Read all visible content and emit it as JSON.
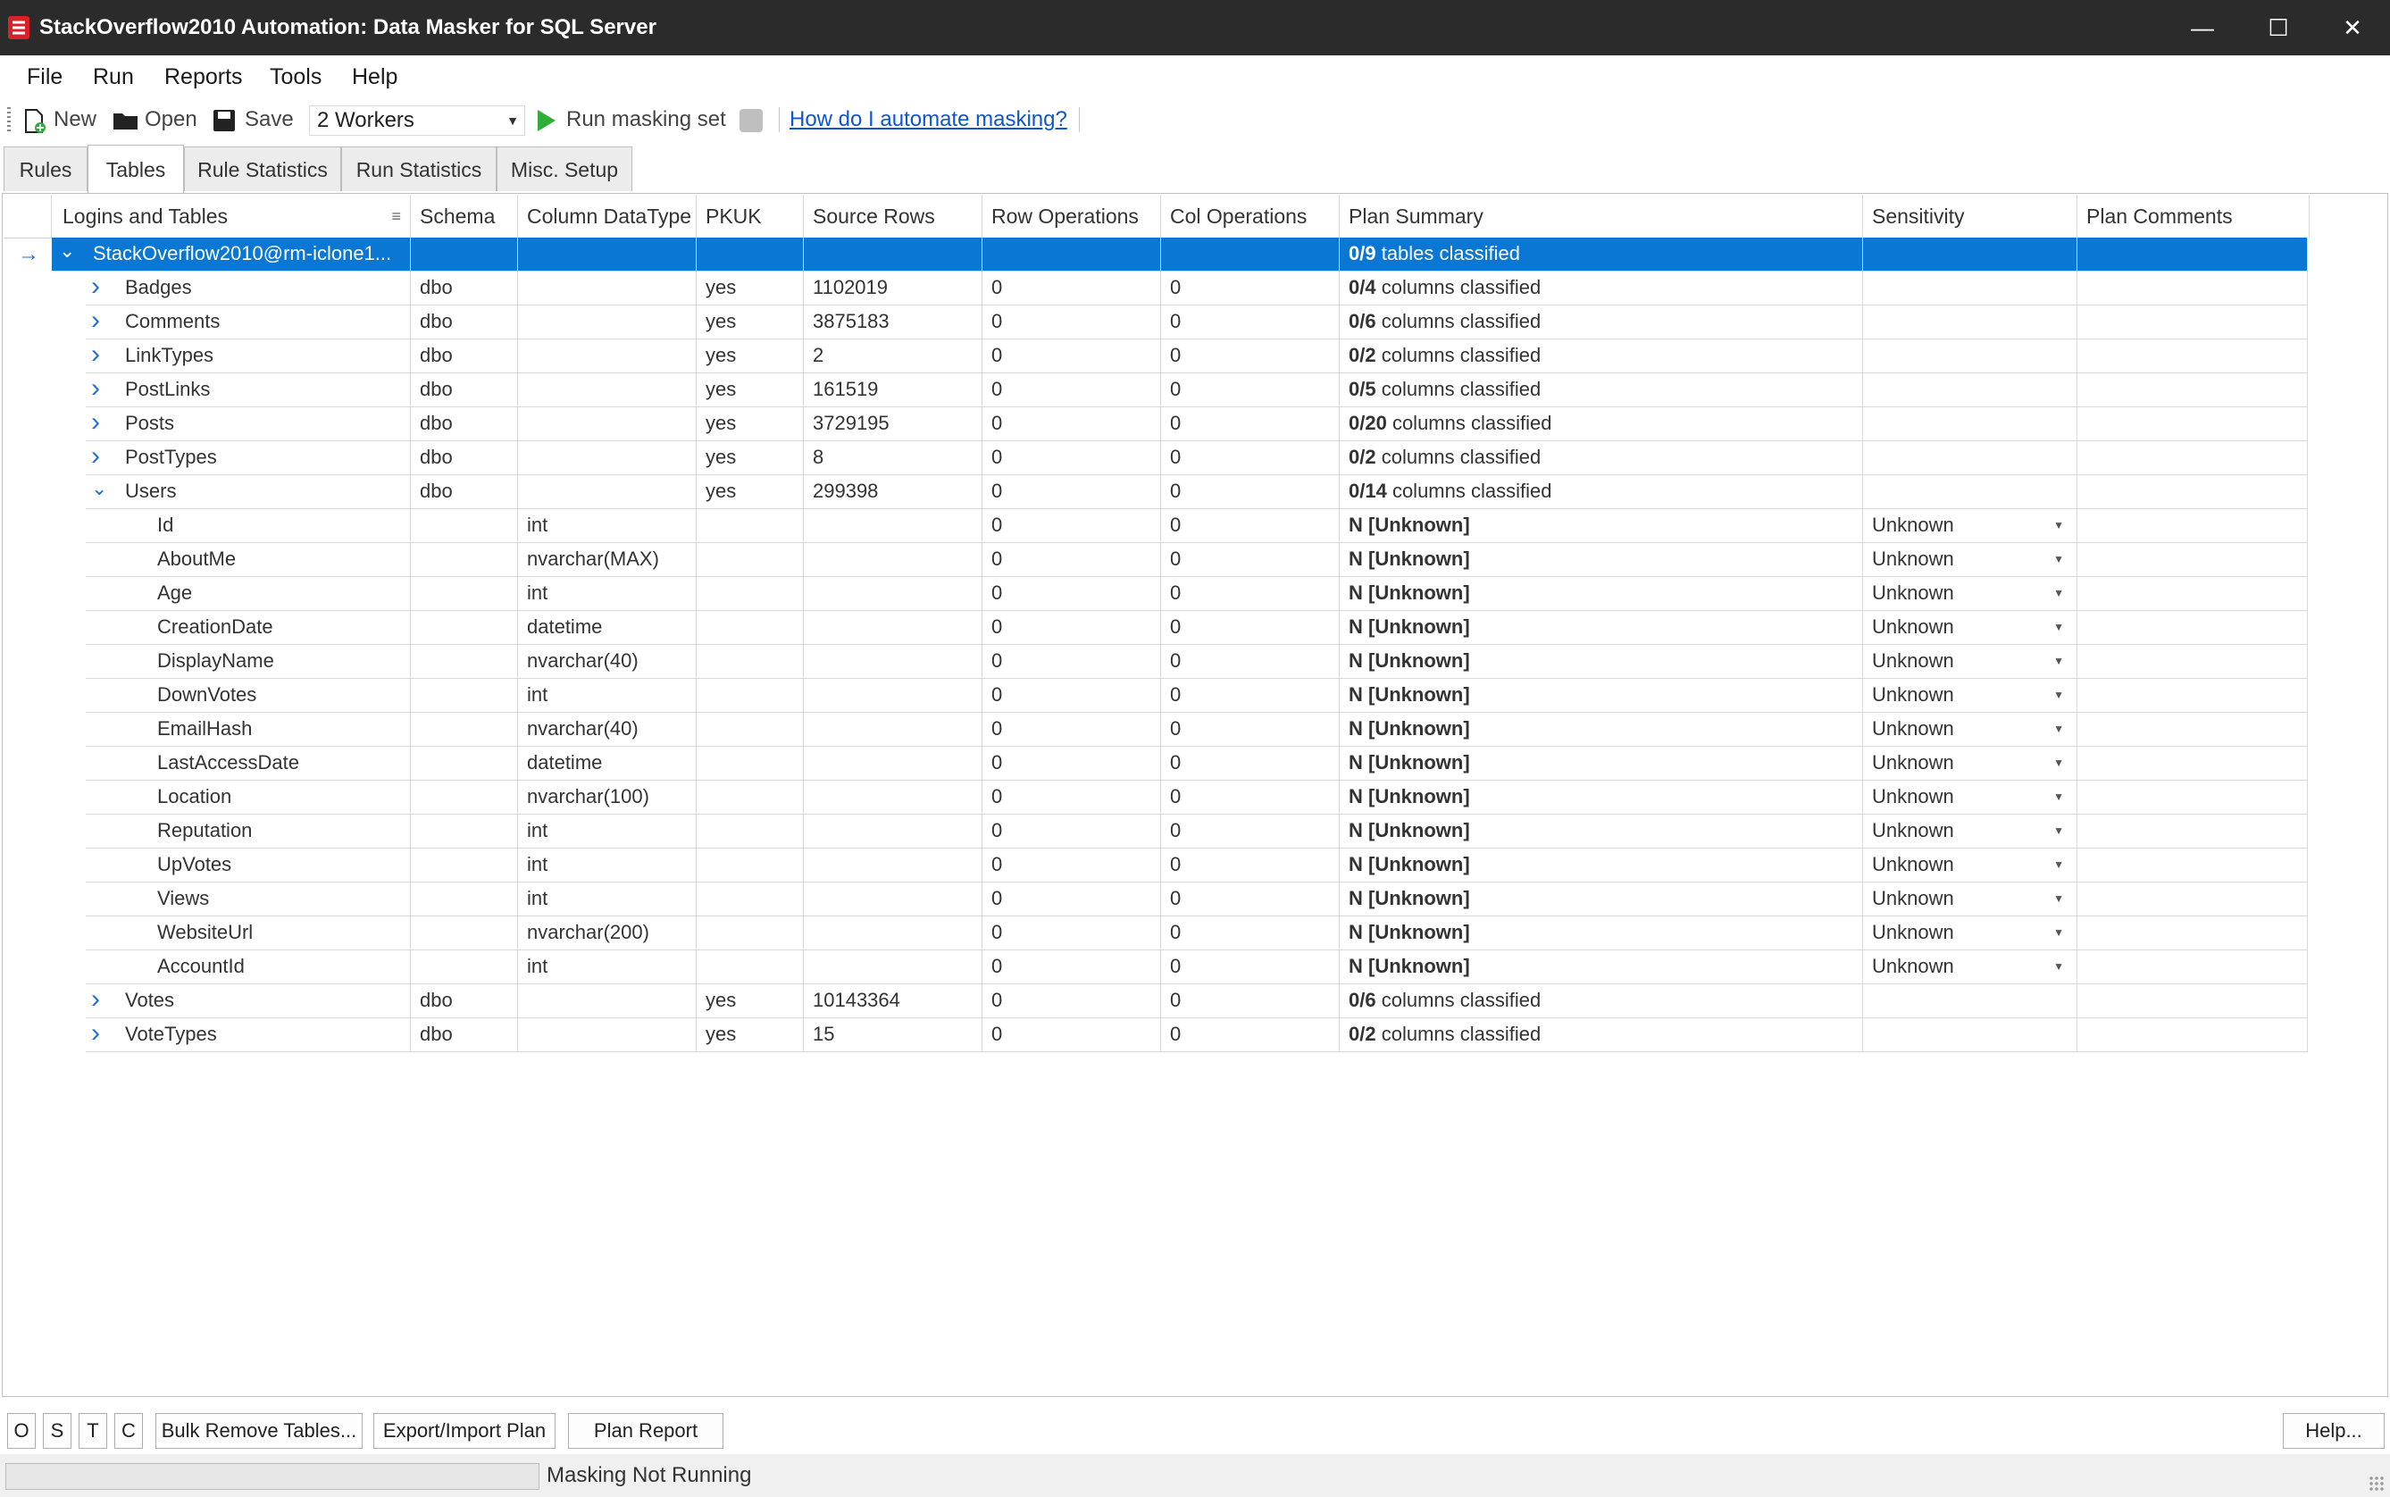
{
  "window": {
    "title": "StackOverflow2010 Automation: Data Masker for SQL Server",
    "minimize": "—",
    "maximize": "☐",
    "close": "✕"
  },
  "menu": [
    "File",
    "Run",
    "Reports",
    "Tools",
    "Help"
  ],
  "toolbar": {
    "new_label": "New",
    "open_label": "Open",
    "save_label": "Save",
    "workers_value": "2 Workers",
    "run_label": "Run masking set",
    "help_link": "How do I automate masking?"
  },
  "tabs": [
    {
      "label": "Rules",
      "active": false
    },
    {
      "label": "Tables",
      "active": true
    },
    {
      "label": "Rule Statistics",
      "active": false
    },
    {
      "label": "Run Statistics",
      "active": false
    },
    {
      "label": "Misc. Setup",
      "active": false
    }
  ],
  "columns": [
    "Logins and Tables",
    "Schema",
    "Column DataType",
    "PKUK",
    "Source Rows",
    "Row Operations",
    "Col Operations",
    "Plan Summary",
    "Sensitivity",
    "Plan Comments"
  ],
  "rows": [
    {
      "level": 0,
      "name": "StackOverflow2010@rm-iclone1...",
      "expander": "⌄",
      "selected": true,
      "schema": "",
      "datatype": "",
      "pkuk": "",
      "source_rows": "",
      "row_ops": "",
      "col_ops": "",
      "plan_bold": "0/9",
      "plan_rest": " tables classified",
      "sensitivity": ""
    },
    {
      "level": 1,
      "name": "Badges",
      "expander": "›",
      "schema": "dbo",
      "datatype": "",
      "pkuk": "yes",
      "source_rows": "1102019",
      "row_ops": "0",
      "col_ops": "0",
      "plan_bold": "0/4",
      "plan_rest": " columns classified",
      "sensitivity": ""
    },
    {
      "level": 1,
      "name": "Comments",
      "expander": "›",
      "schema": "dbo",
      "datatype": "",
      "pkuk": "yes",
      "source_rows": "3875183",
      "row_ops": "0",
      "col_ops": "0",
      "plan_bold": "0/6",
      "plan_rest": " columns classified",
      "sensitivity": ""
    },
    {
      "level": 1,
      "name": "LinkTypes",
      "expander": "›",
      "schema": "dbo",
      "datatype": "",
      "pkuk": "yes",
      "source_rows": "2",
      "row_ops": "0",
      "col_ops": "0",
      "plan_bold": "0/2",
      "plan_rest": " columns classified",
      "sensitivity": ""
    },
    {
      "level": 1,
      "name": "PostLinks",
      "expander": "›",
      "schema": "dbo",
      "datatype": "",
      "pkuk": "yes",
      "source_rows": "161519",
      "row_ops": "0",
      "col_ops": "0",
      "plan_bold": "0/5",
      "plan_rest": " columns classified",
      "sensitivity": ""
    },
    {
      "level": 1,
      "name": "Posts",
      "expander": "›",
      "schema": "dbo",
      "datatype": "",
      "pkuk": "yes",
      "source_rows": "3729195",
      "row_ops": "0",
      "col_ops": "0",
      "plan_bold": "0/20",
      "plan_rest": " columns classified",
      "sensitivity": ""
    },
    {
      "level": 1,
      "name": "PostTypes",
      "expander": "›",
      "schema": "dbo",
      "datatype": "",
      "pkuk": "yes",
      "source_rows": "8",
      "row_ops": "0",
      "col_ops": "0",
      "plan_bold": "0/2",
      "plan_rest": " columns classified",
      "sensitivity": ""
    },
    {
      "level": 1,
      "name": "Users",
      "expander": "⌄",
      "schema": "dbo",
      "datatype": "",
      "pkuk": "yes",
      "source_rows": "299398",
      "row_ops": "0",
      "col_ops": "0",
      "plan_bold": "0/14",
      "plan_rest": " columns classified",
      "sensitivity": ""
    },
    {
      "level": 2,
      "name": "Id",
      "schema": "",
      "datatype": "int",
      "pkuk": "",
      "source_rows": "",
      "row_ops": "0",
      "col_ops": "0",
      "plan_bold": "N [Unknown]",
      "plan_rest": "",
      "sensitivity": "Unknown"
    },
    {
      "level": 2,
      "name": "AboutMe",
      "schema": "",
      "datatype": "nvarchar(MAX)",
      "pkuk": "",
      "source_rows": "",
      "row_ops": "0",
      "col_ops": "0",
      "plan_bold": "N [Unknown]",
      "plan_rest": "",
      "sensitivity": "Unknown"
    },
    {
      "level": 2,
      "name": "Age",
      "schema": "",
      "datatype": "int",
      "pkuk": "",
      "source_rows": "",
      "row_ops": "0",
      "col_ops": "0",
      "plan_bold": "N [Unknown]",
      "plan_rest": "",
      "sensitivity": "Unknown"
    },
    {
      "level": 2,
      "name": "CreationDate",
      "schema": "",
      "datatype": "datetime",
      "pkuk": "",
      "source_rows": "",
      "row_ops": "0",
      "col_ops": "0",
      "plan_bold": "N [Unknown]",
      "plan_rest": "",
      "sensitivity": "Unknown"
    },
    {
      "level": 2,
      "name": "DisplayName",
      "schema": "",
      "datatype": "nvarchar(40)",
      "pkuk": "",
      "source_rows": "",
      "row_ops": "0",
      "col_ops": "0",
      "plan_bold": "N [Unknown]",
      "plan_rest": "",
      "sensitivity": "Unknown"
    },
    {
      "level": 2,
      "name": "DownVotes",
      "schema": "",
      "datatype": "int",
      "pkuk": "",
      "source_rows": "",
      "row_ops": "0",
      "col_ops": "0",
      "plan_bold": "N [Unknown]",
      "plan_rest": "",
      "sensitivity": "Unknown"
    },
    {
      "level": 2,
      "name": "EmailHash",
      "schema": "",
      "datatype": "nvarchar(40)",
      "pkuk": "",
      "source_rows": "",
      "row_ops": "0",
      "col_ops": "0",
      "plan_bold": "N [Unknown]",
      "plan_rest": "",
      "sensitivity": "Unknown"
    },
    {
      "level": 2,
      "name": "LastAccessDate",
      "schema": "",
      "datatype": "datetime",
      "pkuk": "",
      "source_rows": "",
      "row_ops": "0",
      "col_ops": "0",
      "plan_bold": "N [Unknown]",
      "plan_rest": "",
      "sensitivity": "Unknown"
    },
    {
      "level": 2,
      "name": "Location",
      "schema": "",
      "datatype": "nvarchar(100)",
      "pkuk": "",
      "source_rows": "",
      "row_ops": "0",
      "col_ops": "0",
      "plan_bold": "N [Unknown]",
      "plan_rest": "",
      "sensitivity": "Unknown"
    },
    {
      "level": 2,
      "name": "Reputation",
      "schema": "",
      "datatype": "int",
      "pkuk": "",
      "source_rows": "",
      "row_ops": "0",
      "col_ops": "0",
      "plan_bold": "N [Unknown]",
      "plan_rest": "",
      "sensitivity": "Unknown"
    },
    {
      "level": 2,
      "name": "UpVotes",
      "schema": "",
      "datatype": "int",
      "pkuk": "",
      "source_rows": "",
      "row_ops": "0",
      "col_ops": "0",
      "plan_bold": "N [Unknown]",
      "plan_rest": "",
      "sensitivity": "Unknown"
    },
    {
      "level": 2,
      "name": "Views",
      "schema": "",
      "datatype": "int",
      "pkuk": "",
      "source_rows": "",
      "row_ops": "0",
      "col_ops": "0",
      "plan_bold": "N [Unknown]",
      "plan_rest": "",
      "sensitivity": "Unknown"
    },
    {
      "level": 2,
      "name": "WebsiteUrl",
      "schema": "",
      "datatype": "nvarchar(200)",
      "pkuk": "",
      "source_rows": "",
      "row_ops": "0",
      "col_ops": "0",
      "plan_bold": "N [Unknown]",
      "plan_rest": "",
      "sensitivity": "Unknown"
    },
    {
      "level": 2,
      "name": "AccountId",
      "schema": "",
      "datatype": "int",
      "pkuk": "",
      "source_rows": "",
      "row_ops": "0",
      "col_ops": "0",
      "plan_bold": "N [Unknown]",
      "plan_rest": "",
      "sensitivity": "Unknown"
    },
    {
      "level": 1,
      "name": "Votes",
      "expander": "›",
      "schema": "dbo",
      "datatype": "",
      "pkuk": "yes",
      "source_rows": "10143364",
      "row_ops": "0",
      "col_ops": "0",
      "plan_bold": "0/6",
      "plan_rest": " columns classified",
      "sensitivity": ""
    },
    {
      "level": 1,
      "name": "VoteTypes",
      "expander": "›",
      "schema": "dbo",
      "datatype": "",
      "pkuk": "yes",
      "source_rows": "15",
      "row_ops": "0",
      "col_ops": "0",
      "plan_bold": "0/2",
      "plan_rest": " columns classified",
      "sensitivity": ""
    }
  ],
  "bottom_buttons": {
    "o": "O",
    "s": "S",
    "t": "T",
    "c": "C",
    "bulk_remove": "Bulk Remove Tables...",
    "export_import": "Export/Import Plan",
    "plan_report": "Plan Report",
    "help": "Help..."
  },
  "status": {
    "text": "Masking Not Running",
    "progress": 0
  },
  "colors": {
    "selection": "#0a77d5",
    "titlebar": "#2b2b2b",
    "link": "#1155cc",
    "run_icon": "#2fae3c"
  }
}
